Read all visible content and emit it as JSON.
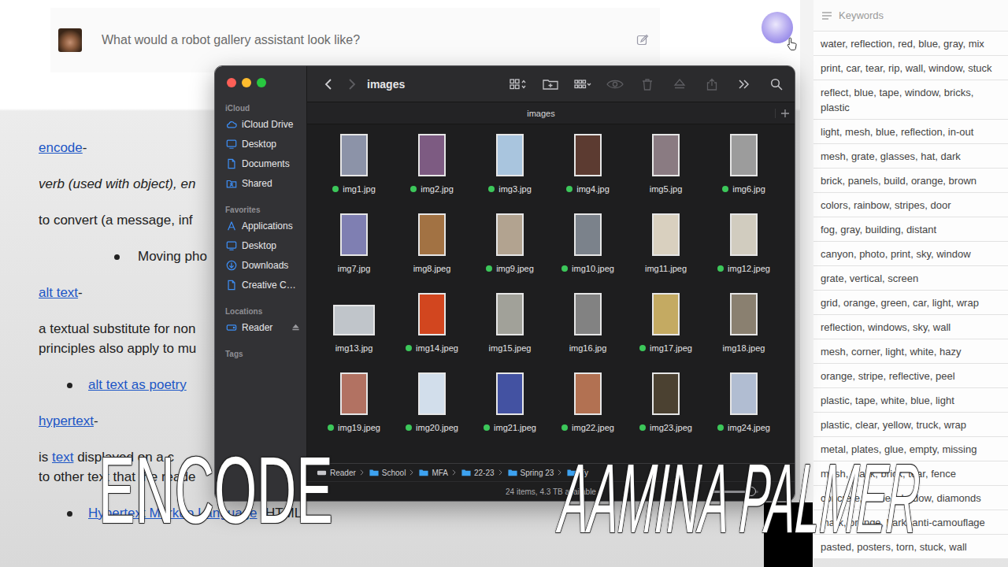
{
  "chat": {
    "prompt": "What would a robot gallery assistant look like?"
  },
  "document": {
    "lines": [
      {
        "kind": "term",
        "segments": [
          {
            "text": "encode",
            "link": true
          },
          {
            "text": "-",
            "link": false
          }
        ]
      },
      {
        "kind": "italic",
        "segments": [
          {
            "text": "verb (used with object), en",
            "link": false
          }
        ]
      },
      {
        "kind": "para",
        "segments": [
          {
            "text": "to convert (a message, inf",
            "link": false
          }
        ]
      },
      {
        "kind": "bullet-deep",
        "segments": [
          {
            "text": "Moving pho",
            "link": false
          }
        ]
      },
      {
        "kind": "term",
        "segments": [
          {
            "text": "alt text",
            "link": true
          },
          {
            "text": "-",
            "link": false
          }
        ]
      },
      {
        "kind": "para",
        "segments": [
          {
            "text": "a textual substitute for non",
            "link": false
          }
        ]
      },
      {
        "kind": "cont",
        "segments": [
          {
            "text": "principles also apply to mu",
            "link": false
          }
        ]
      },
      {
        "kind": "bullet",
        "segments": [
          {
            "text": "alt text as poetry",
            "link": true
          }
        ]
      },
      {
        "kind": "term",
        "segments": [
          {
            "text": "hypertext",
            "link": true
          },
          {
            "text": "-",
            "link": false
          }
        ]
      },
      {
        "kind": "para",
        "segments": [
          {
            "text": "is ",
            "link": false
          },
          {
            "text": "text",
            "link": true
          },
          {
            "text": " displayed on a c",
            "link": false
          }
        ]
      },
      {
        "kind": "cont",
        "segments": [
          {
            "text": "to other text that the reade",
            "link": false
          }
        ]
      },
      {
        "kind": "bullet",
        "segments": [
          {
            "text": "Hypertext Markup Language",
            "link": true
          },
          {
            "text": " (HTML)",
            "link": false
          }
        ]
      }
    ]
  },
  "finder": {
    "sidebar": [
      {
        "heading": "iCloud",
        "items": [
          {
            "label": "iCloud Drive",
            "kind": "cloud",
            "ejectable": false
          },
          {
            "label": "Desktop",
            "kind": "desktop",
            "ejectable": false
          },
          {
            "label": "Documents",
            "kind": "document",
            "ejectable": false
          },
          {
            "label": "Shared",
            "kind": "shared",
            "ejectable": false
          }
        ]
      },
      {
        "heading": "Favorites",
        "items": [
          {
            "label": "Applications",
            "kind": "apps",
            "ejectable": false
          },
          {
            "label": "Desktop",
            "kind": "desktop",
            "ejectable": false
          },
          {
            "label": "Downloads",
            "kind": "download",
            "ejectable": false
          },
          {
            "label": "Creative C…",
            "kind": "document",
            "ejectable": false
          }
        ]
      },
      {
        "heading": "Locations",
        "items": [
          {
            "label": "Reader",
            "kind": "drive",
            "ejectable": true
          }
        ]
      },
      {
        "heading": "Tags",
        "items": []
      }
    ],
    "toolbar": {
      "title": "images",
      "back_disabled": false,
      "forward_disabled": true,
      "tools": [
        {
          "kind": "view-grid",
          "disabled": false
        },
        {
          "kind": "new-folder",
          "disabled": false
        },
        {
          "kind": "group",
          "disabled": false
        },
        {
          "kind": "quick-look",
          "disabled": true
        },
        {
          "kind": "trash",
          "disabled": true
        },
        {
          "kind": "eject",
          "disabled": true
        },
        {
          "kind": "share",
          "disabled": true
        },
        {
          "kind": "more",
          "disabled": false
        },
        {
          "kind": "search",
          "disabled": false
        }
      ]
    },
    "tab": {
      "label": "images"
    },
    "files": [
      {
        "name": "img1.jpg",
        "tagged": true,
        "kind": "portrait",
        "color": "#8c93a8"
      },
      {
        "name": "img2.jpg",
        "tagged": true,
        "kind": "portrait",
        "color": "#7d5b82"
      },
      {
        "name": "img3.jpg",
        "tagged": true,
        "kind": "portrait",
        "color": "#a9c5de"
      },
      {
        "name": "img4.jpg",
        "tagged": true,
        "kind": "portrait",
        "color": "#5c3b31"
      },
      {
        "name": "img5.jpg",
        "tagged": false,
        "kind": "portrait",
        "color": "#8a7b82"
      },
      {
        "name": "img6.jpg",
        "tagged": true,
        "kind": "portrait",
        "color": "#9c9c9c"
      },
      {
        "name": "img7.jpg",
        "tagged": false,
        "kind": "portrait",
        "color": "#7f7fb2"
      },
      {
        "name": "img8.jpeg",
        "tagged": false,
        "kind": "portrait",
        "color": "#a27243"
      },
      {
        "name": "img9.jpeg",
        "tagged": true,
        "kind": "portrait",
        "color": "#b2a390"
      },
      {
        "name": "img10.jpeg",
        "tagged": true,
        "kind": "portrait",
        "color": "#7b828b"
      },
      {
        "name": "img11.jpeg",
        "tagged": false,
        "kind": "portrait",
        "color": "#d9d0bf"
      },
      {
        "name": "img12.jpeg",
        "tagged": true,
        "kind": "portrait",
        "color": "#d1ccbf"
      },
      {
        "name": "img13.jpg",
        "tagged": false,
        "kind": "landscape",
        "color": "#c0c5ca"
      },
      {
        "name": "img14.jpeg",
        "tagged": true,
        "kind": "portrait",
        "color": "#d2461f"
      },
      {
        "name": "img15.jpeg",
        "tagged": false,
        "kind": "portrait",
        "color": "#a1a199"
      },
      {
        "name": "img16.jpg",
        "tagged": false,
        "kind": "portrait",
        "color": "#828282"
      },
      {
        "name": "img17.jpeg",
        "tagged": true,
        "kind": "portrait",
        "color": "#c4aa62"
      },
      {
        "name": "img18.jpeg",
        "tagged": false,
        "kind": "portrait",
        "color": "#8a8070"
      },
      {
        "name": "img19.jpeg",
        "tagged": true,
        "kind": "portrait",
        "color": "#b27262"
      },
      {
        "name": "img20.jpeg",
        "tagged": true,
        "kind": "portrait",
        "color": "#d2deeb"
      },
      {
        "name": "img21.jpeg",
        "tagged": true,
        "kind": "portrait",
        "color": "#4352a2"
      },
      {
        "name": "img22.jpeg",
        "tagged": true,
        "kind": "portrait",
        "color": "#b27152"
      },
      {
        "name": "img23.jpeg",
        "tagged": true,
        "kind": "portrait",
        "color": "#4b4131"
      },
      {
        "name": "img24.jpeg",
        "tagged": true,
        "kind": "portrait",
        "color": "#b1bdd2"
      }
    ],
    "path": [
      {
        "label": "Reader",
        "kind": "drive"
      },
      {
        "label": "School",
        "kind": "folder"
      },
      {
        "label": "MFA",
        "kind": "folder"
      },
      {
        "label": "22-23",
        "kind": "folder"
      },
      {
        "label": "Spring 23",
        "kind": "folder"
      },
      {
        "label": "Ty",
        "kind": "folder"
      }
    ],
    "status": "24 items, 4.3 TB available",
    "zoom": {
      "level": 0.85
    }
  },
  "keywords": {
    "title": "Keywords",
    "rows": [
      "water, reflection, red, blue, gray, mix",
      "print, car, tear, rip, wall, window, stuck",
      "reflect, blue, tape, window, bricks, plastic",
      "light, mesh, blue, reflection, in-out",
      "mesh, grate, glasses, hat, dark",
      "brick, panels, build, orange, brown",
      "colors, rainbow, stripes, door",
      "fog, gray, building, distant",
      "canyon, photo, print, sky, window",
      "grate, vertical, screen",
      "grid, orange, green, car, light, wrap",
      "reflection, windows, sky, wall",
      "mesh, corner, light, white, hazy",
      "orange, stripe, reflective, peel",
      "plastic, tape, white, blue, light",
      "plastic, clear, yellow, truck, wrap",
      "metal, plates, glue, empty, missing",
      "mesh, black, brick, tear, fence",
      "concrete, stone, shadow, diamonds",
      "mark, orange, bark, anti-camouflage",
      "pasted, posters, torn, stuck, wall"
    ]
  },
  "overlay": {
    "title": "ENCODE",
    "author": "AAMINA PALMER"
  }
}
